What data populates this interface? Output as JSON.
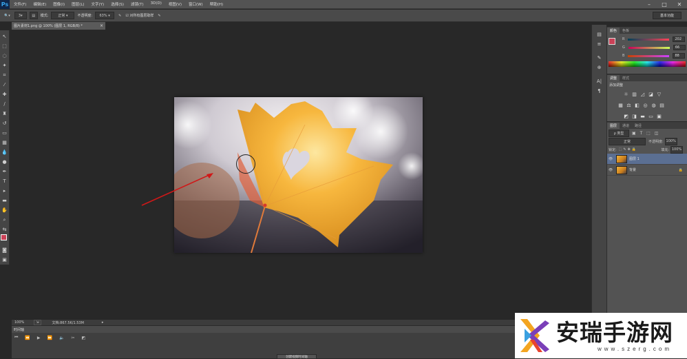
{
  "app": {
    "logo": "Ps"
  },
  "menu": [
    "文件(F)",
    "编辑(E)",
    "图像(I)",
    "图层(L)",
    "文字(Y)",
    "选择(S)",
    "滤镜(T)",
    "3D(D)",
    "视图(V)",
    "窗口(W)",
    "帮助(H)"
  ],
  "options": {
    "brush_size": "3",
    "mode_label": "模式:",
    "mode_value": "正常",
    "opacity_label": "不透明度:",
    "opacity_value": "63%",
    "smooth_label": "对所有图层取样",
    "essentials": "基本功能"
  },
  "document": {
    "tab_title": "图片素材1.png @ 100% (图层 1, RGB/8) *",
    "zoom": "100%",
    "doc_info": "文档:867.5K/1.53M"
  },
  "timeline": {
    "title": "时间轴",
    "create_video": "创建视频时间轴"
  },
  "color_panel": {
    "tabs": [
      "颜色",
      "色板"
    ],
    "r": "202",
    "g": "66",
    "b": "88",
    "r_label": "R",
    "g_label": "G",
    "b_label": "B",
    "fg_color": "#ca4258"
  },
  "adjust_panel": {
    "tabs": [
      "调整",
      "样式"
    ],
    "header": "添加调整"
  },
  "layers_panel": {
    "tabs": [
      "图层",
      "通道",
      "路径"
    ],
    "kind_label": "ρ 类型",
    "blend": "正常",
    "opacity_label": "不透明度:",
    "opacity": "100%",
    "lock_label": "锁定:",
    "fill_label": "填充:",
    "fill": "100%",
    "layers": [
      {
        "name": "图层 1",
        "selected": true
      },
      {
        "name": "背景",
        "selected": false,
        "locked": true
      }
    ]
  },
  "watermark": {
    "brand": "安瑞手游网",
    "url": "www.szerg.com"
  }
}
